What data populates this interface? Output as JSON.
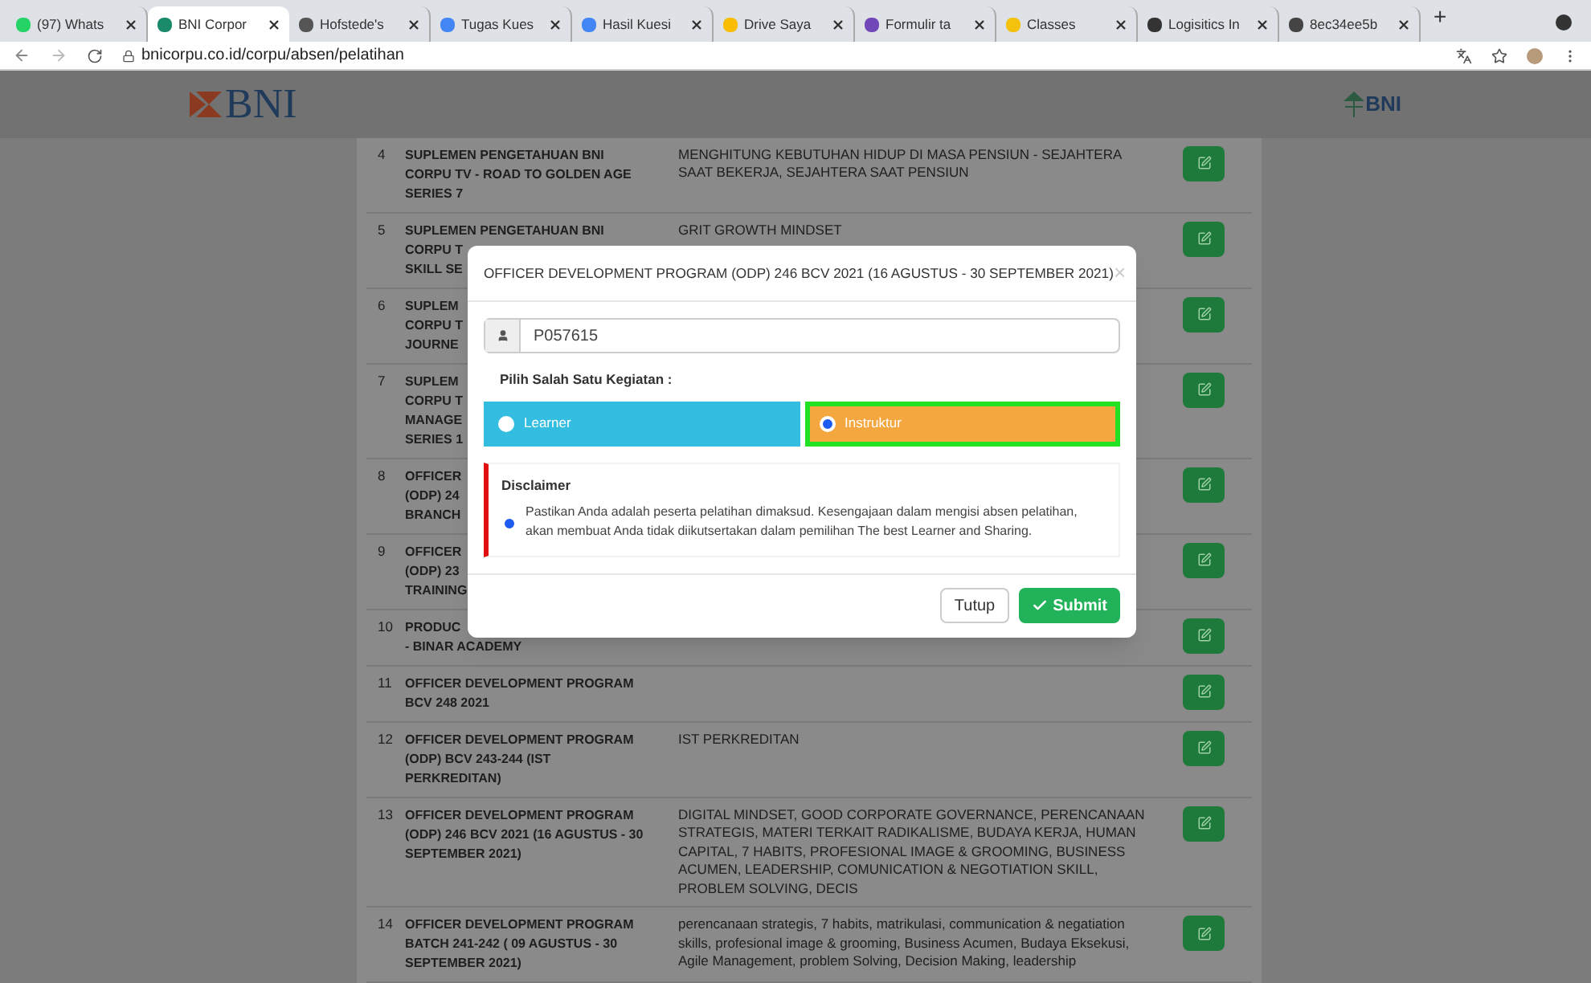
{
  "browser": {
    "tabs": [
      {
        "label": "(97) Whats",
        "color": "#25d366",
        "selected": false
      },
      {
        "label": "BNI Corpor",
        "color": "#1a8a6a",
        "selected": true
      },
      {
        "label": "Hofstede's",
        "color": "#555555",
        "selected": false
      },
      {
        "label": "Tugas Kues",
        "color": "#4285f4",
        "selected": false
      },
      {
        "label": "Hasil Kuesi",
        "color": "#4285f4",
        "selected": false
      },
      {
        "label": "Drive Saya",
        "color": "#fbbc04",
        "selected": false
      },
      {
        "label": "Formulir ta",
        "color": "#7248b9",
        "selected": false
      },
      {
        "label": "Classes",
        "color": "#f4c20d",
        "selected": false
      },
      {
        "label": "Logisitics In",
        "color": "#333333",
        "selected": false
      },
      {
        "label": "8ec34ee5b",
        "color": "#444444",
        "selected": false
      }
    ],
    "new_tab": "+",
    "address": "bnicorpu.co.id/corpu/absen/pelatihan"
  },
  "header": {
    "left_logo": "BNI",
    "right_logo": "BNI"
  },
  "rows": [
    {
      "no": "4",
      "title": [
        "SUPLEMEN PENGETAHUAN BNI",
        "CORPU TV - ROAD TO GOLDEN AGE",
        "SERIES 7"
      ],
      "desc": "MENGHITUNG KEBUTUHAN HIDUP DI MASA PENSIUN - SEJAHTERA SAAT BEKERJA, SEJAHTERA SAAT PENSIUN"
    },
    {
      "no": "5",
      "title": [
        "SUPLEMEN PENGETAHUAN BNI",
        "CORPU T",
        "SKILL SE"
      ],
      "desc": "GRIT GROWTH MINDSET"
    },
    {
      "no": "6",
      "title": [
        "SUPLEM",
        "CORPU T",
        "JOURNE"
      ]
    },
    {
      "no": "7",
      "title": [
        "SUPLEM",
        "CORPU T",
        "MANAGE",
        "SERIES 1"
      ]
    },
    {
      "no": "8",
      "title": [
        "OFFICER",
        "(ODP) 24",
        "BRANCH"
      ]
    },
    {
      "no": "9",
      "title": [
        "OFFICER",
        "(ODP) 23",
        "TRAINING"
      ]
    },
    {
      "no": "10",
      "title": [
        "PRODUC",
        "- BINAR ACADEMY"
      ]
    },
    {
      "no": "11",
      "title": [
        "OFFICER DEVELOPMENT PROGRAM",
        "BCV 248 2021"
      ]
    },
    {
      "no": "12",
      "title": [
        "OFFICER DEVELOPMENT PROGRAM",
        "(ODP) BCV 243-244 (IST",
        "PERKREDITAN)"
      ],
      "desc": "IST PERKREDITAN"
    },
    {
      "no": "13",
      "title": [
        "OFFICER DEVELOPMENT PROGRAM",
        "(ODP) 246 BCV 2021 (16 AGUSTUS - 30",
        "SEPTEMBER 2021)"
      ],
      "desc": "DIGITAL MINDSET, GOOD CORPORATE GOVERNANCE, PERENCANAAN STRATEGIS, MATERI TERKAIT RADIKALISME, BUDAYA KERJA, HUMAN CAPITAL, 7 HABITS, PROFESIONAL IMAGE & GROOMING, BUSINESS ACUMEN, LEADERSHIP, COMUNICATION & NEGOTIATION SKILL, PROBLEM SOLVING, DECIS"
    },
    {
      "no": "14",
      "title": [
        "OFFICER DEVELOPMENT PROGRAM",
        "BATCH 241-242 ( 09 AGUSTUS - 30",
        "SEPTEMBER 2021)"
      ],
      "desc": "perencanaan strategis, 7 habits, matrikulasi, communication & negatiation skills, profesional image & grooming, Business Acumen, Budaya Eksekusi, Agile Management, problem Solving, Decision Making, leadership"
    }
  ],
  "modal": {
    "title": "OFFICER DEVELOPMENT PROGRAM (ODP) 246 BCV 2021 (16 AGUSTUS - 30 SEPTEMBER 2021)",
    "close": "×",
    "user_id": "P057615",
    "prompt": "Pilih Salah Satu Kegiatan :",
    "options": [
      {
        "label": "Learner",
        "kind": "learner",
        "selected": false
      },
      {
        "label": "Instruktur",
        "kind": "instructor",
        "selected": true
      }
    ],
    "disclaimer": {
      "heading": "Disclaimer",
      "text": "Pastikan Anda adalah peserta pelatihan dimaksud. Kesengajaan dalam mengisi absen pelatihan, akan membuat Anda tidak diikutsertakan dalam pemilihan The best Learner and Sharing.",
      "checked": true
    },
    "buttons": [
      {
        "label": "Tutup",
        "kind": "close"
      },
      {
        "label": "Submit",
        "kind": "submit"
      }
    ]
  }
}
